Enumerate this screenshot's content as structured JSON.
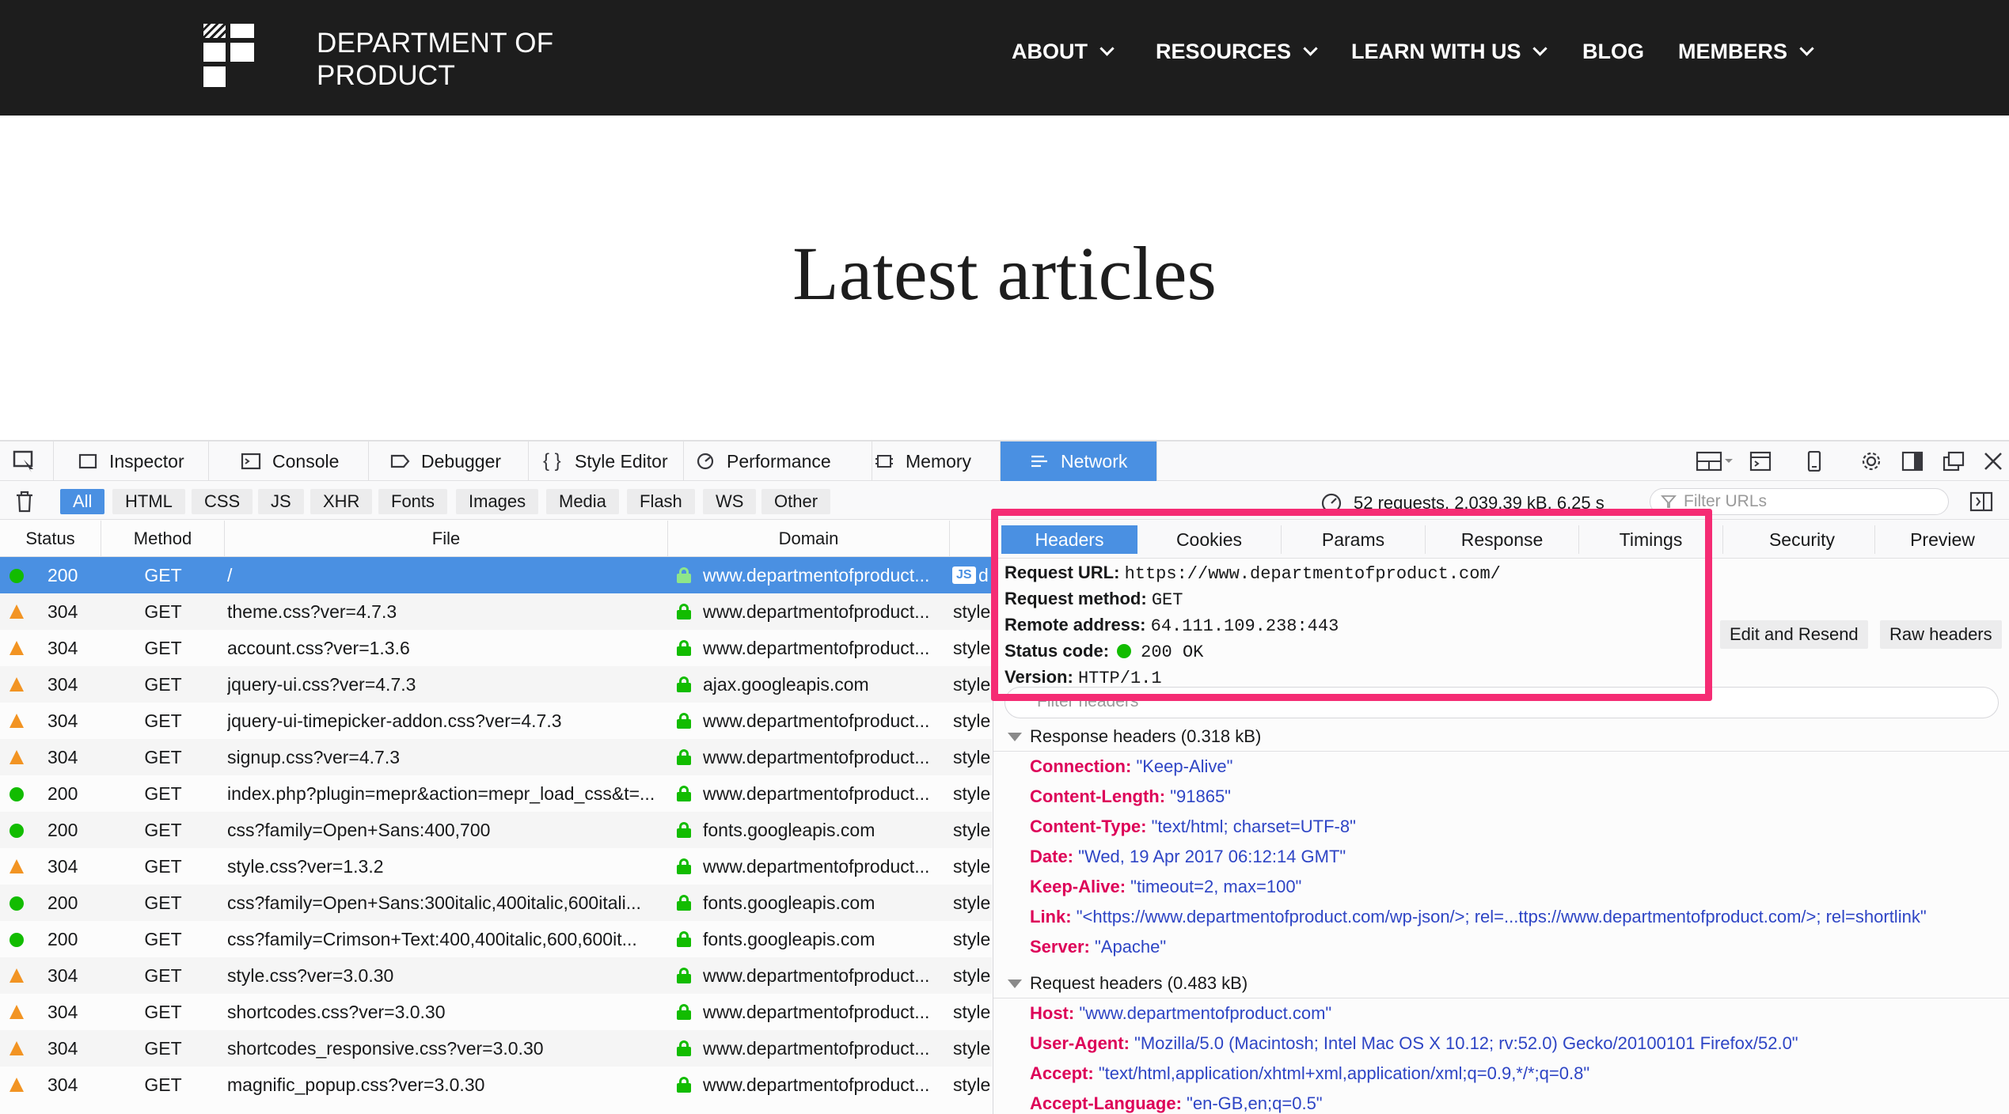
{
  "site": {
    "logo_line1": "DEPARTMENT OF",
    "logo_line2": "PRODUCT",
    "nav": [
      {
        "label": "ABOUT",
        "dropdown": true
      },
      {
        "label": "RESOURCES",
        "dropdown": true
      },
      {
        "label": "LEARN WITH US",
        "dropdown": true
      },
      {
        "label": "BLOG",
        "dropdown": false
      },
      {
        "label": "MEMBERS",
        "dropdown": true
      }
    ],
    "hero_title": "Latest articles"
  },
  "devtools": {
    "tools": [
      {
        "label": "Inspector",
        "icon": "inspector-icon"
      },
      {
        "label": "Console",
        "icon": "console-icon"
      },
      {
        "label": "Debugger",
        "icon": "debugger-icon"
      },
      {
        "label": "Style Editor",
        "icon": "style-editor-icon"
      },
      {
        "label": "Performance",
        "icon": "performance-icon"
      },
      {
        "label": "Memory",
        "icon": "memory-icon"
      },
      {
        "label": "Network",
        "icon": "network-icon",
        "active": true
      }
    ],
    "type_filters": [
      "All",
      "HTML",
      "CSS",
      "JS",
      "XHR",
      "Fonts",
      "Images",
      "Media",
      "Flash",
      "WS",
      "Other"
    ],
    "summary": "52 requests, 2,039.39 kB, 6.25 s",
    "filter_urls_placeholder": "Filter URLs",
    "columns": [
      "Status",
      "Method",
      "File",
      "Domain"
    ],
    "requests": [
      {
        "status": "200",
        "ok": true,
        "method": "GET",
        "file": "/",
        "domain": "www.departmentofproduct...",
        "type": "d"
      },
      {
        "status": "304",
        "ok": false,
        "method": "GET",
        "file": "theme.css?ver=4.7.3",
        "domain": "www.departmentofproduct...",
        "type": "style"
      },
      {
        "status": "304",
        "ok": false,
        "method": "GET",
        "file": "account.css?ver=1.3.6",
        "domain": "www.departmentofproduct...",
        "type": "style"
      },
      {
        "status": "304",
        "ok": false,
        "method": "GET",
        "file": "jquery-ui.css?ver=4.7.3",
        "domain": "ajax.googleapis.com",
        "type": "style"
      },
      {
        "status": "304",
        "ok": false,
        "method": "GET",
        "file": "jquery-ui-timepicker-addon.css?ver=4.7.3",
        "domain": "www.departmentofproduct...",
        "type": "style"
      },
      {
        "status": "304",
        "ok": false,
        "method": "GET",
        "file": "signup.css?ver=4.7.3",
        "domain": "www.departmentofproduct...",
        "type": "style"
      },
      {
        "status": "200",
        "ok": true,
        "method": "GET",
        "file": "index.php?plugin=mepr&action=mepr_load_css&t=...",
        "domain": "www.departmentofproduct...",
        "type": "style"
      },
      {
        "status": "200",
        "ok": true,
        "method": "GET",
        "file": "css?family=Open+Sans:400,700",
        "domain": "fonts.googleapis.com",
        "type": "style"
      },
      {
        "status": "304",
        "ok": false,
        "method": "GET",
        "file": "style.css?ver=1.3.2",
        "domain": "www.departmentofproduct...",
        "type": "style"
      },
      {
        "status": "200",
        "ok": true,
        "method": "GET",
        "file": "css?family=Open+Sans:300italic,400italic,600itali...",
        "domain": "fonts.googleapis.com",
        "type": "style"
      },
      {
        "status": "200",
        "ok": true,
        "method": "GET",
        "file": "css?family=Crimson+Text:400,400italic,600,600it...",
        "domain": "fonts.googleapis.com",
        "type": "style"
      },
      {
        "status": "304",
        "ok": false,
        "method": "GET",
        "file": "style.css?ver=3.0.30",
        "domain": "www.departmentofproduct...",
        "type": "style"
      },
      {
        "status": "304",
        "ok": false,
        "method": "GET",
        "file": "shortcodes.css?ver=3.0.30",
        "domain": "www.departmentofproduct...",
        "type": "style"
      },
      {
        "status": "304",
        "ok": false,
        "method": "GET",
        "file": "shortcodes_responsive.css?ver=3.0.30",
        "domain": "www.departmentofproduct...",
        "type": "style"
      },
      {
        "status": "304",
        "ok": false,
        "method": "GET",
        "file": "magnific_popup.css?ver=3.0.30",
        "domain": "www.departmentofproduct...",
        "type": "style"
      }
    ],
    "detail_tabs": [
      "Headers",
      "Cookies",
      "Params",
      "Response",
      "Timings",
      "Security",
      "Preview"
    ],
    "detail": {
      "url_label": "Request URL:",
      "url": "https://www.departmentofproduct.com/",
      "method_label": "Request method:",
      "method": "GET",
      "remote_label": "Remote address:",
      "remote": "64.111.109.238:443",
      "status_label": "Status code:",
      "status": "200 OK",
      "version_label": "Version:",
      "version": "HTTP/1.1",
      "edit_resend": "Edit and Resend",
      "raw_headers": "Raw headers",
      "filter_headers_placeholder": "Filter headers",
      "response_section": "Response headers (0.318 kB)",
      "response_headers": [
        {
          "k": "Connection:",
          "v": "\"Keep-Alive\""
        },
        {
          "k": "Content-Length:",
          "v": "\"91865\""
        },
        {
          "k": "Content-Type:",
          "v": "\"text/html; charset=UTF-8\""
        },
        {
          "k": "Date:",
          "v": "\"Wed, 19 Apr 2017 06:12:14 GMT\""
        },
        {
          "k": "Keep-Alive:",
          "v": "\"timeout=2, max=100\""
        },
        {
          "k": "Link:",
          "v": "\"<https://www.departmentofproduct.com/wp-json/>; rel=...ttps://www.departmentofproduct.com/>; rel=shortlink\""
        },
        {
          "k": "Server:",
          "v": "\"Apache\""
        }
      ],
      "request_section": "Request headers (0.483 kB)",
      "request_headers": [
        {
          "k": "Host:",
          "v": "\"www.departmentofproduct.com\""
        },
        {
          "k": "User-Agent:",
          "v": "\"Mozilla/5.0 (Macintosh; Intel Mac OS X 10.12; rv:52.0) Gecko/20100101 Firefox/52.0\""
        },
        {
          "k": "Accept:",
          "v": "\"text/html,application/xhtml+xml,application/xml;q=0.9,*/*;q=0.8\""
        },
        {
          "k": "Accept-Language:",
          "v": "\"en-GB,en;q=0.5\""
        }
      ]
    }
  },
  "colors": {
    "header_bg": "#1d1d1d",
    "accent": "#4a90e2",
    "ok_green": "#12bc00",
    "warn_orange": "#f29423",
    "header_key": "#dd0058",
    "header_value": "#2e45c5",
    "highlight": "#f52c74"
  }
}
